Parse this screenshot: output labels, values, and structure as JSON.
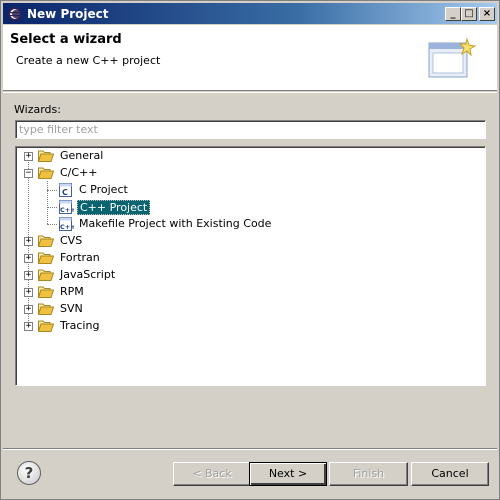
{
  "window": {
    "title": "New Project",
    "min_glyph": "_",
    "max_glyph": "□",
    "close_glyph": "×"
  },
  "header": {
    "title": "Select a wizard",
    "description": "Create a new C++ project"
  },
  "wizards": {
    "label": "Wizards:",
    "filter_placeholder": "type filter text",
    "filter_value": ""
  },
  "tree": {
    "items": [
      {
        "label": "General",
        "expander": "+"
      },
      {
        "label": "C/C++",
        "expander": "−"
      },
      {
        "label": "C Project"
      },
      {
        "label": "C++ Project",
        "selected": true
      },
      {
        "label": "Makefile Project with Existing Code"
      },
      {
        "label": "CVS",
        "expander": "+"
      },
      {
        "label": "Fortran",
        "expander": "+"
      },
      {
        "label": "JavaScript",
        "expander": "+"
      },
      {
        "label": "RPM",
        "expander": "+"
      },
      {
        "label": "SVN",
        "expander": "+"
      },
      {
        "label": "Tracing",
        "expander": "+"
      }
    ]
  },
  "buttons": {
    "help": "?",
    "back": "< Back",
    "next": "Next >",
    "finish": "Finish",
    "cancel": "Cancel"
  },
  "colors": {
    "selection": "#0a6470",
    "titlebar": "#0a246a",
    "folder": "#f0c040"
  }
}
